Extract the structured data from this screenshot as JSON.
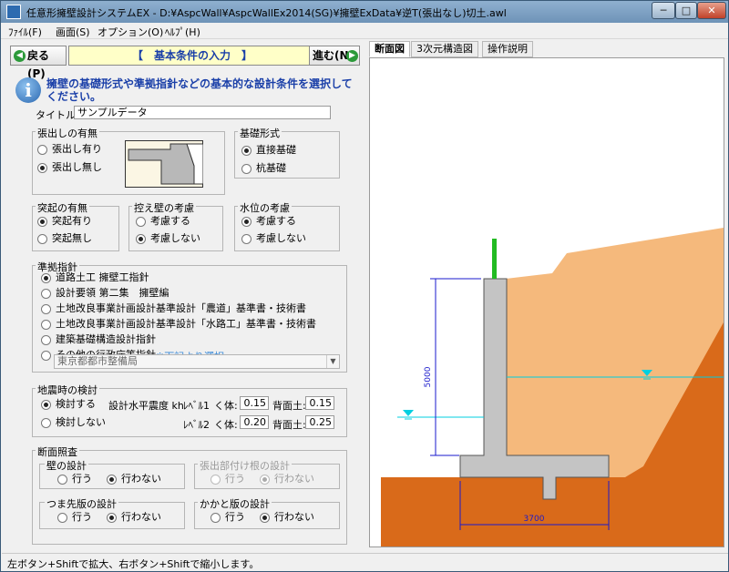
{
  "window": {
    "title": "任意形擁壁設計システムEX - D:¥AspcWall¥AspcWallEx2014(SG)¥擁壁ExData¥逆T(張出なし)切土.awl",
    "min_label": "─",
    "max_label": "□",
    "close_label": "✕"
  },
  "menu": {
    "file": "ﾌｧｲﾙ(F)",
    "view": "画面(S)",
    "option": "オプション(O)",
    "help": "ﾍﾙﾌﾟ(H)"
  },
  "nav": {
    "back_label": "戻る(P)",
    "next_label": "進む(N)",
    "title": "【　基本条件の入力　】"
  },
  "info_text": "擁壁の基礎形式や準拠指針などの基本的な設計条件を選択してください。",
  "title_field": {
    "label": "タイトル:",
    "value": "サンプルデータ"
  },
  "overhang": {
    "label": "張出しの有無",
    "options": [
      "張出し有り",
      "張出し無し"
    ],
    "selected": 1
  },
  "foundation": {
    "label": "基礎形式",
    "options": [
      "直接基礎",
      "杭基礎"
    ],
    "selected": 0
  },
  "protrusion": {
    "label": "突起の有無",
    "options": [
      "突起有り",
      "突起無し"
    ],
    "selected": 0
  },
  "buttress": {
    "label": "控え壁の考慮",
    "options": [
      "考慮する",
      "考慮しない"
    ],
    "selected": 1
  },
  "water": {
    "label": "水位の考慮",
    "options": [
      "考慮する",
      "考慮しない"
    ],
    "selected": 0
  },
  "standard": {
    "label": "準拠指針",
    "options": [
      "道路土工 擁壁工指針",
      "設計要領 第二集　擁壁編",
      "土地改良事業計画設計基準設計「農道」基準書・技術書",
      "土地改良事業計画設計基準設計「水路工」基準書・技術書",
      "建築基礎構造設計指針",
      "その他の行政庁等指針"
    ],
    "selected": 0,
    "note": "※下記より選択",
    "dropdown_value": "東京都都市整備局"
  },
  "seismic": {
    "label": "地震時の検討",
    "options": [
      "検討する",
      "検討しない"
    ],
    "selected": 0,
    "coef_label": "設計水平震度 kh",
    "level1": "ﾚﾍﾞﾙ1",
    "level2": "ﾚﾍﾞﾙ2",
    "body_label": "く体:",
    "back_label": "背面土:",
    "l1_body": "0.15",
    "l1_back": "0.15",
    "l2_body": "0.20",
    "l2_back": "0.25"
  },
  "section_check": {
    "label": "断面照査",
    "wall": {
      "label": "壁の設計",
      "options": [
        "行う",
        "行わない"
      ],
      "selected": 1
    },
    "overhang_base": {
      "label": "張出部付け根の設計",
      "options": [
        "行う",
        "行わない"
      ],
      "selected": 1
    },
    "toe": {
      "label": "つま先版の設計",
      "options": [
        "行う",
        "行わない"
      ],
      "selected": 1
    },
    "heel": {
      "label": "かかと版の設計",
      "options": [
        "行う",
        "行わない"
      ],
      "selected": 1
    }
  },
  "tabs": [
    "断面図",
    "3次元構造図",
    "操作説明"
  ],
  "active_tab": 0,
  "drawing": {
    "height_dim": "5000",
    "width_dim": "3700",
    "colors": {
      "backfill": "#f5b97c",
      "ground": "#d96a1a",
      "concrete": "#c4c4c4",
      "water": "#00cfe0",
      "dimension": "#1a1acc",
      "rail": "#22bb22"
    }
  },
  "status_text": "左ボタン+Shiftで拡大、右ボタン+Shiftで縮小します。"
}
